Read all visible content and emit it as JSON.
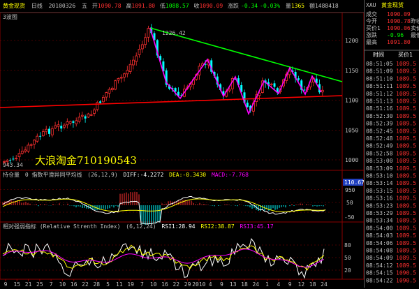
{
  "header": {
    "symbol": "黄金现货",
    "period": "日线",
    "date": "20100326",
    "weekday": "五",
    "open_label": "开",
    "open": "1090.78",
    "high_label": "高",
    "high": "1091.80",
    "low_label": "低",
    "low": "1088.57",
    "close_label": "收",
    "close": "1090.09",
    "change_label": "涨跌",
    "change": "-0.34",
    "change_pct": "-0.03%",
    "volume_label": "量",
    "volume": "1365",
    "amount_label": "额",
    "amount": "1488418"
  },
  "main_pane": {
    "label": "3波图",
    "high_marker": "1226.42",
    "low_marker": "943.34",
    "y_ticks": [
      "1200",
      "1150",
      "1100",
      "1050",
      "1000",
      "950"
    ],
    "watermark": "大浪淘金710190543"
  },
  "macd_pane": {
    "label": "持仓量",
    "indicator": "0 指数平滑异同平均线",
    "params": "(26,12,9)",
    "diff_label": "DIFF",
    "diff": "-4.2272",
    "dea_label": "DEA",
    "dea": "-0.3430",
    "macd_label": "MACD",
    "macd": "-7.768",
    "y_ticks": [
      "110.67",
      "50",
      "-50"
    ]
  },
  "rsi_pane": {
    "label": "相对强弱指标 (Relative Strenth Index)",
    "params": "(6,12,24)",
    "rsi1_label": "RSI1",
    "rsi1": "28.94",
    "rsi2_label": "RSI2",
    "rsi2": "38.87",
    "rsi3_label": "RSI3",
    "rsi3": "45.17",
    "y_ticks": [
      "80",
      "50",
      "20"
    ]
  },
  "x_axis": {
    "labels": [
      "9",
      "15",
      "21",
      "25",
      "7",
      "10",
      "16",
      "22",
      "28",
      "5",
      "11",
      "19",
      "7",
      "10",
      "16",
      "22",
      "29",
      "2010",
      "4",
      "9",
      "13",
      "18",
      "24",
      "1",
      "4",
      "9",
      "12",
      "18",
      "24"
    ]
  },
  "quote_panel": {
    "code": "XAU",
    "name": "黄金现货",
    "rows": [
      {
        "label": "成交",
        "value": "1090.09",
        "extra": ""
      },
      {
        "label": "今开",
        "value": "1090.78",
        "extra": "昨收"
      },
      {
        "label": "买价1",
        "value": "1090.06",
        "extra": "卖价"
      },
      {
        "label": "涨跌",
        "value": "-0.96",
        "extra": "最低"
      },
      {
        "label": "最高",
        "value": "1091.80",
        "extra": ""
      }
    ],
    "list_header": {
      "time": "时间",
      "price": "买价1"
    },
    "trades": [
      {
        "time": "08:51:05",
        "price": "1089.5"
      },
      {
        "time": "08:51:09",
        "price": "1089.5"
      },
      {
        "time": "08:51:10",
        "price": "1089.5"
      },
      {
        "time": "08:51:11",
        "price": "1089.5"
      },
      {
        "time": "08:51:12",
        "price": "1089.5"
      },
      {
        "time": "08:51:13",
        "price": "1089.5"
      },
      {
        "time": "08:51:16",
        "price": "1089.5"
      },
      {
        "time": "08:52:30",
        "price": "1089.5"
      },
      {
        "time": "08:52:39",
        "price": "1089.5"
      },
      {
        "time": "08:52:45",
        "price": "1089.5"
      },
      {
        "time": "08:52:48",
        "price": "1089.5"
      },
      {
        "time": "08:52:49",
        "price": "1089.5"
      },
      {
        "time": "08:52:58",
        "price": "1089.5"
      },
      {
        "time": "08:53:00",
        "price": "1089.5"
      },
      {
        "time": "08:53:09",
        "price": "1089.5"
      },
      {
        "time": "08:53:10",
        "price": "1089.5"
      },
      {
        "time": "08:53:14",
        "price": "1089.5"
      },
      {
        "time": "08:53:15",
        "price": "1089.5"
      },
      {
        "time": "08:53:16",
        "price": "1089.5"
      },
      {
        "time": "08:53:23",
        "price": "1089.5"
      },
      {
        "time": "08:53:29",
        "price": "1089.5"
      },
      {
        "time": "08:53:34",
        "price": "1089.5"
      },
      {
        "time": "08:54:00",
        "price": "1089.5"
      },
      {
        "time": "08:54:03",
        "price": "1089.5"
      },
      {
        "time": "08:54:06",
        "price": "1089.5"
      },
      {
        "time": "08:54:08",
        "price": "1089.5"
      },
      {
        "time": "08:54:09",
        "price": "1089.5"
      },
      {
        "time": "08:54:12",
        "price": "1089.5"
      },
      {
        "time": "08:54:15",
        "price": "1090.5"
      },
      {
        "time": "08:54:22",
        "price": "1090.5"
      }
    ]
  },
  "colors": {
    "up": "#ff3030",
    "down": "#00ffff",
    "trend_upper": "#00ff00",
    "trend_lower": "#ff0000",
    "zigzag": "#ff00ff",
    "watermark": "#ffff00",
    "grid": "#8b0000",
    "label_blue": "#4040ff",
    "diff_line": "#ffffff",
    "dea_line": "#ffff00",
    "rsi1": "#ffffff",
    "rsi2": "#ffff00",
    "rsi3": "#ff00ff"
  }
}
